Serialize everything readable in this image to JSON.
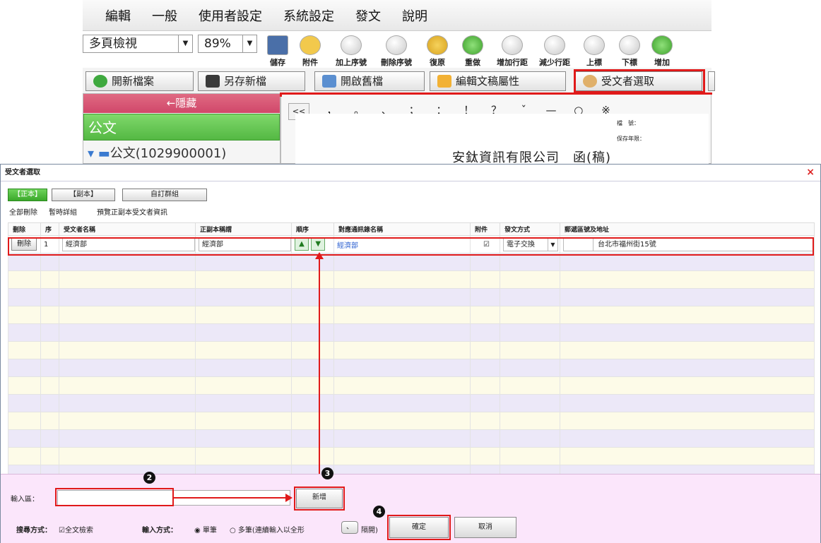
{
  "menu": [
    "編輯",
    "一般",
    "使用者設定",
    "系統設定",
    "發文",
    "說明"
  ],
  "toolbar": {
    "view_select": "多頁檢視",
    "zoom_select": "89%",
    "buttons": [
      "儲存",
      "附件",
      "加上序號",
      "刪除序號",
      "復原",
      "重做",
      "增加行距",
      "減少行距",
      "上標",
      "下標",
      "增加"
    ]
  },
  "actions": {
    "new_file": "開新檔案",
    "save_as": "另存新檔",
    "open_old": "開啟舊檔",
    "edit_props": "編輯文稿屬性",
    "select_recipient": "受文者選取"
  },
  "left_panel": {
    "hide": "←隱藏",
    "category": "公文",
    "folder": "公文(1029900001)"
  },
  "doc": {
    "collapse": "<<",
    "punct": [
      "，",
      "。",
      "、",
      "；",
      "：",
      "！",
      "？",
      "ˇ",
      "—",
      "○",
      "※"
    ],
    "field1": "檔　號：",
    "field2": "保存年限：",
    "header": "安鈦資訊有限公司　函(稿)"
  },
  "dialog": {
    "title": "受文者選取",
    "close": "×",
    "tabs": [
      "【正本】",
      "【副本】",
      "自訂群組"
    ],
    "links": [
      "全部刪除",
      "暫時詳組",
      "預覽正副本受文者資訊"
    ],
    "columns": [
      "刪除",
      "序",
      "受文者名稱",
      "正副本稱謂",
      "順序",
      "對應通訊錄名稱",
      "附件",
      "發文方式",
      "郵遞區號及地址"
    ],
    "row": {
      "delete": "刪除",
      "seq": "1",
      "name": "經濟部",
      "title": "經濟部",
      "contact": "經濟部",
      "send_method": "電子交換",
      "address": "台北市福州街15號"
    },
    "input_label": "輸入區：",
    "add_button": "新增",
    "search_label": "搜尋方式：",
    "search_option": "全文檢索",
    "input_mode_label": "輸入方式：",
    "mode_single": "單筆",
    "mode_multi": "多筆(連續輸入以全形",
    "separator_key": "、",
    "separator_suffix": "隔開)",
    "confirm": "確定",
    "cancel": "取消",
    "badges": [
      "2",
      "3",
      "4"
    ]
  }
}
